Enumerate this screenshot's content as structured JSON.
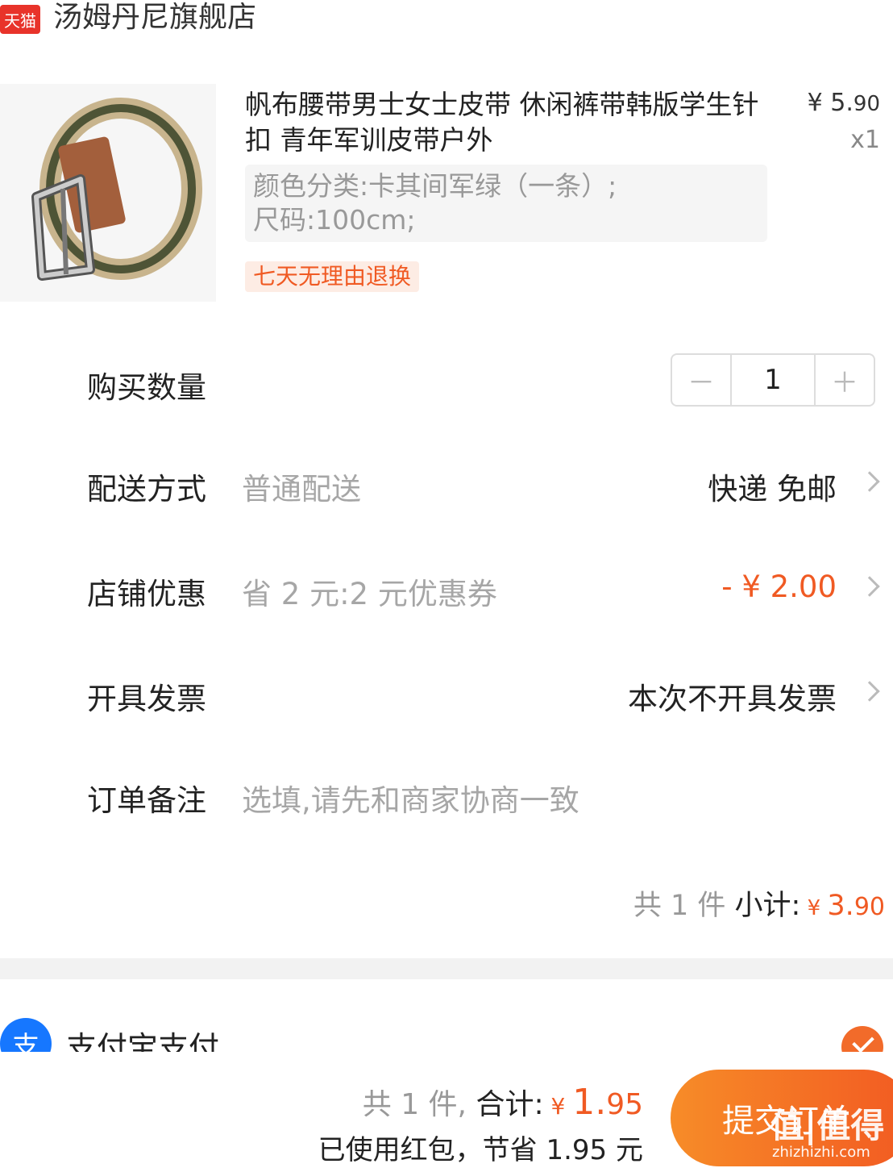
{
  "store": {
    "badge": "天猫",
    "name": "汤姆丹尼旗舰店"
  },
  "product": {
    "title": "帆布腰带男士女士皮带 休闲裤带韩版学生针扣 青年军训皮带户外",
    "price_currency": "¥ ",
    "price_main": "5.",
    "price_cents": "90",
    "quantity_mult": "x1",
    "sku_line1": "颜色分类:卡其间军绿（一条）;",
    "sku_line2": "尺码:100cm;",
    "return_tag": "七天无理由退换"
  },
  "quantity": {
    "label": "购买数量",
    "value": "1",
    "minus": "－",
    "plus": "＋"
  },
  "shipping": {
    "label": "配送方式",
    "sub": "普通配送",
    "value": "快递 免邮"
  },
  "discount": {
    "label": "店铺优惠",
    "sub": "省 2 元:2 元优惠券",
    "value": "- ¥ 2.00"
  },
  "invoice": {
    "label": "开具发票",
    "value": "本次不开具发票"
  },
  "remark": {
    "label": "订单备注",
    "placeholder": "选填,请先和商家协商一致"
  },
  "subtotal": {
    "count_text": "共 1 件",
    "label": " 小计:",
    "currency": " ¥ ",
    "amount_main": "3.",
    "amount_cents": "90"
  },
  "payment": {
    "icon_char": "支",
    "label": "支付宝支付"
  },
  "footer": {
    "count_text": "共 1 件,",
    "total_label": " 合计:",
    "currency": " ¥ ",
    "total_main": "1.",
    "total_cents": "95",
    "saving_text": "已使用红包，节省 1.95 元",
    "submit_label": "提交订单",
    "watermark": "值|值得",
    "watermark_sub": "zhizhizhi.com"
  },
  "colors": {
    "accent": "#f05a23",
    "tmall_red": "#e8332a",
    "alipay_blue": "#1677ff"
  }
}
